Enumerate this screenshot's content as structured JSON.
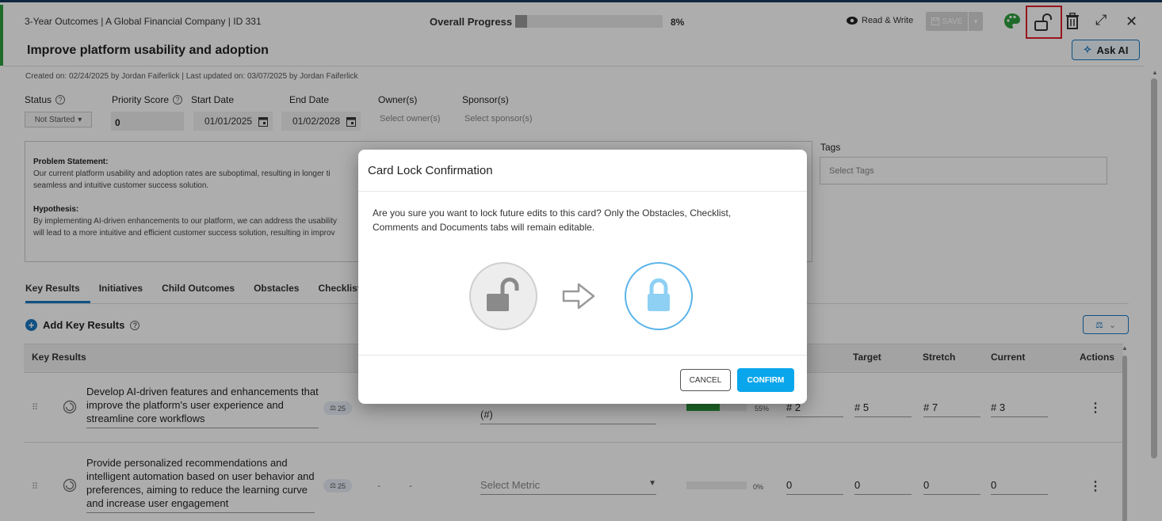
{
  "header": {
    "breadcrumb": "3-Year Outcomes  |  A Global Financial Company  |  ID 331",
    "progress_label": "Overall Progress",
    "progress_value": 0.08,
    "progress_text": "8%",
    "mode_label": "Read & Write",
    "save_label": "SAVE",
    "title": "Improve platform usability and adoption",
    "ask_ai_label": "Ask AI",
    "icons": [
      "eye-icon",
      "save-icon",
      "palette-icon",
      "unlock-icon",
      "trash-icon",
      "expand-icon",
      "close-icon"
    ]
  },
  "meta": {
    "text": "Created on: 02/24/2025 by Jordan Faiferlick  |  Last updated on: 03/07/2025 by Jordan Faiferlick"
  },
  "fields": {
    "status_label": "Status",
    "status_value": "Not Started",
    "priority_label": "Priority Score",
    "priority_value": "0",
    "start_label": "Start Date",
    "start_value": "01/01/2025",
    "end_label": "End Date",
    "end_value": "01/02/2028",
    "owner_label": "Owner(s)",
    "owner_placeholder": "Select owner(s)",
    "sponsor_label": "Sponsor(s)",
    "sponsor_placeholder": "Select sponsor(s)"
  },
  "problem": {
    "ps_heading": "Problem Statement:",
    "ps_line1": "Our current platform usability and adoption rates are suboptimal, resulting in longer ti",
    "ps_line2": "seamless and intuitive customer success solution.",
    "hyp_heading": "Hypothesis:",
    "hyp_line1": "By implementing AI-driven enhancements to our platform, we can address the usability",
    "hyp_line2": "will lead to a more intuitive and efficient customer success solution, resulting in improv"
  },
  "tags": {
    "label": "Tags",
    "placeholder": "Select Tags"
  },
  "tabs": [
    "Key Results",
    "Initiatives",
    "Child Outcomes",
    "Obstacles",
    "Checklist"
  ],
  "key_results": {
    "add_label": "Add Key Results",
    "columns": {
      "key_results": "Key Results",
      "target": "Target",
      "stretch": "Stretch",
      "current": "Current",
      "actions": "Actions"
    },
    "rows": [
      {
        "line1": "Develop AI-driven features and enhancements that",
        "line2": "improve the platform's user experience and",
        "line3": "streamline core workflows",
        "line4": "",
        "weight": "25",
        "metric": "(#)",
        "progress": 0.55,
        "pct": "55%",
        "baseline": "# 2",
        "target": "# 5",
        "stretch": "# 7",
        "current": "# 3",
        "menu": "⋮"
      },
      {
        "line1": "Provide personalized recommendations and",
        "line2": "intelligent automation based on user behavior and",
        "line3": "preferences, aiming to reduce the learning curve",
        "line4": "and increase user engagement",
        "weight": "25",
        "dash1": "-",
        "dash2": "-",
        "metric": "Select Metric",
        "progress": 0,
        "pct": "0%",
        "baseline": "0",
        "target": "0",
        "stretch": "0",
        "current": "0",
        "menu": "⋮"
      }
    ]
  },
  "modal": {
    "title": "Card Lock Confirmation",
    "body_line1": "Are you sure you want to lock future edits to this card? Only the Obstacles, Checklist,",
    "body_line2": "Comments and Documents tabs will remain editable.",
    "cancel_label": "CANCEL",
    "confirm_label": "CONFIRM",
    "confirm_color": "#0aa6ec"
  },
  "colors": {
    "accent": "#1a78c2",
    "highlight": "#e0202a",
    "progress_green": "#2e9e3e"
  }
}
